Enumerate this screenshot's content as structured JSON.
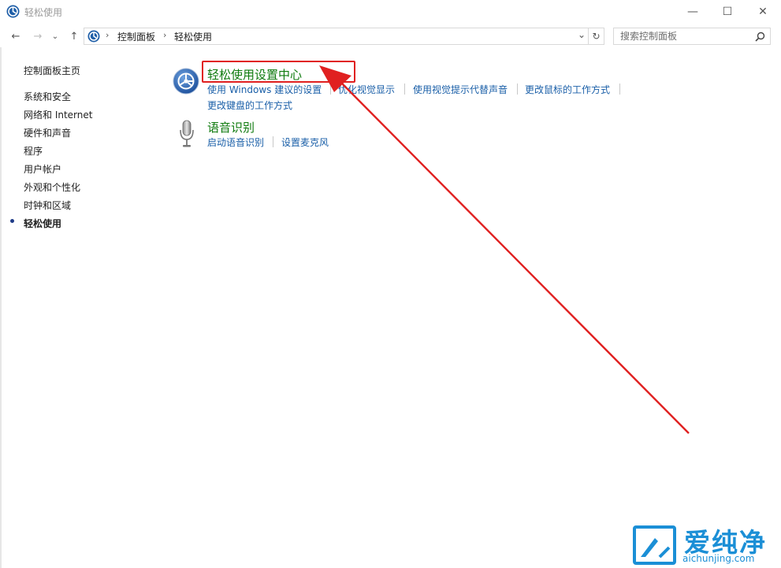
{
  "window": {
    "title": "轻松使用",
    "minimize_label": "—",
    "maximize_label": "☐",
    "close_label": "✕"
  },
  "address_bar": {
    "back_icon": "←",
    "forward_icon": "→",
    "history_icon": "⌄",
    "up_icon": "↑",
    "crumbs": [
      "控制面板",
      "轻松使用"
    ],
    "separator": "›",
    "dropdown_icon": "⌄",
    "refresh_icon": "↻"
  },
  "search": {
    "placeholder": "搜索控制面板",
    "value": ""
  },
  "sidebar": {
    "home": "控制面板主页",
    "items": [
      {
        "label": "系统和安全"
      },
      {
        "label": "网络和 Internet"
      },
      {
        "label": "硬件和声音"
      },
      {
        "label": "程序"
      },
      {
        "label": "用户帐户"
      },
      {
        "label": "外观和个性化"
      },
      {
        "label": "时钟和区域"
      },
      {
        "label": "轻松使用",
        "active": true
      }
    ]
  },
  "main": {
    "categories": [
      {
        "title": "轻松使用设置中心",
        "icon": "ease-of-access-icon",
        "links": [
          "使用 Windows 建议的设置",
          "优化视觉显示",
          "使用视觉提示代替声音",
          "更改鼠标的工作方式",
          "更改键盘的工作方式"
        ]
      },
      {
        "title": "语音识别",
        "icon": "microphone-icon",
        "links": [
          "启动语音识别",
          "设置麦克风"
        ]
      }
    ]
  },
  "watermark": {
    "brand": "爱纯净",
    "url": "aichunjing.com"
  },
  "colors": {
    "category_title": "#0e7a0d",
    "link": "#1a5fa8",
    "highlight": "#e02020",
    "watermark": "#1b8fd6"
  }
}
